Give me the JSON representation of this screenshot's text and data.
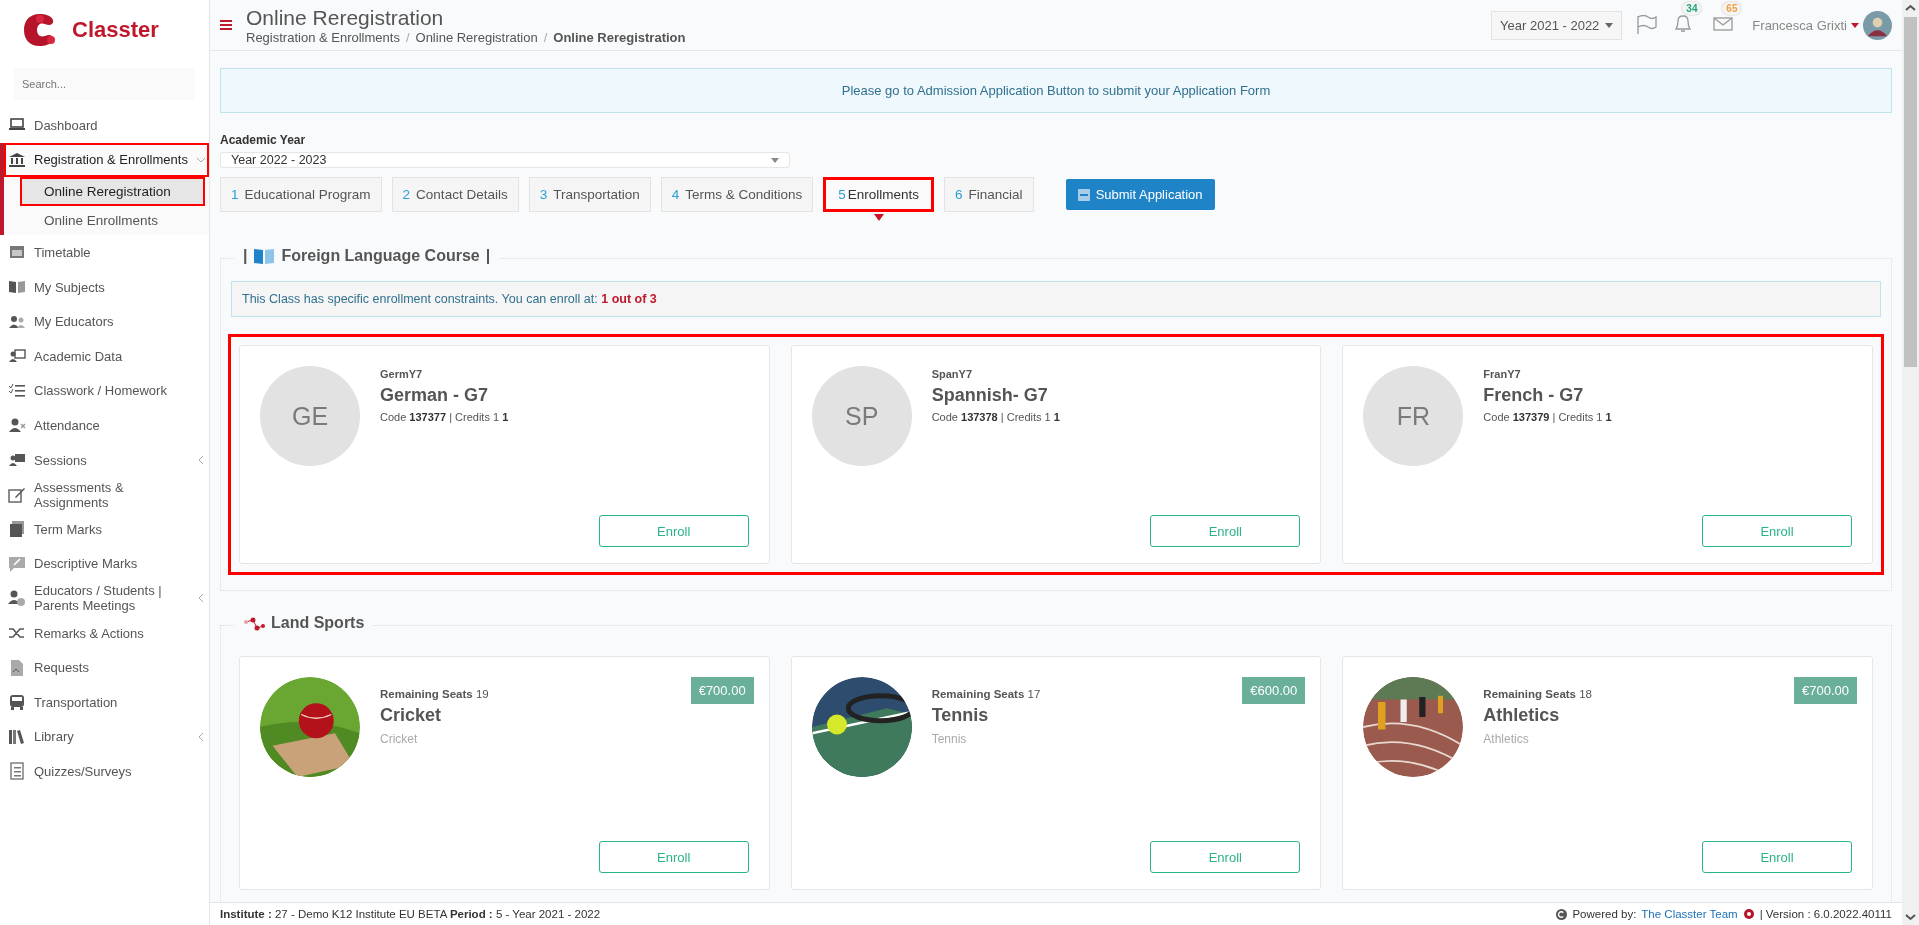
{
  "sidebar": {
    "brand": "Classter",
    "search": {
      "placeholder": "Search..."
    },
    "items": [
      {
        "label": "Dashboard",
        "kind": "link",
        "selected": false,
        "highlighted": false
      },
      {
        "label": "Registration & Enrollments",
        "kind": "menu",
        "expanded": true,
        "selected": true,
        "highlighted": true,
        "children": [
          {
            "label": "Online Reregistration",
            "selected": true,
            "highlighted": true
          },
          {
            "label": "Online Enrollments",
            "selected": false,
            "highlighted": false
          }
        ]
      },
      {
        "label": "Timetable",
        "kind": "link",
        "selected": false,
        "highlighted": false
      },
      {
        "label": "My Subjects",
        "kind": "link",
        "selected": false,
        "highlighted": false
      },
      {
        "label": "My Educators",
        "kind": "link",
        "selected": false,
        "highlighted": false
      },
      {
        "label": "Academic Data",
        "kind": "link",
        "selected": false,
        "highlighted": false
      },
      {
        "label": "Classwork / Homework",
        "kind": "link",
        "selected": false,
        "highlighted": false
      },
      {
        "label": "Attendance",
        "kind": "link",
        "selected": false,
        "highlighted": false
      },
      {
        "label": "Sessions",
        "kind": "menu",
        "expanded": false,
        "selected": false,
        "highlighted": false
      },
      {
        "label": "Assessments & Assignments",
        "kind": "link",
        "selected": false,
        "highlighted": false
      },
      {
        "label": "Term Marks",
        "kind": "link",
        "selected": false,
        "highlighted": false
      },
      {
        "label": "Descriptive Marks",
        "kind": "link",
        "selected": false,
        "highlighted": false
      },
      {
        "label": "Educators / Students | Parents Meetings",
        "kind": "menu",
        "expanded": false,
        "selected": false,
        "highlighted": false
      },
      {
        "label": "Remarks & Actions",
        "kind": "link",
        "selected": false,
        "highlighted": false
      },
      {
        "label": "Requests",
        "kind": "link",
        "selected": false,
        "highlighted": false
      },
      {
        "label": "Transportation",
        "kind": "link",
        "selected": false,
        "highlighted": false
      },
      {
        "label": "Library",
        "kind": "menu",
        "expanded": false,
        "selected": false,
        "highlighted": false
      },
      {
        "label": "Quizzes/Surveys",
        "kind": "link",
        "selected": false,
        "highlighted": false
      }
    ]
  },
  "header": {
    "title": "Online Reregistration",
    "breadcrumbs": [
      {
        "kind": "link",
        "label": "Registration & Enrollments"
      },
      {
        "kind": "separator",
        "label": "/"
      },
      {
        "kind": "link",
        "label": "Online Reregistration"
      },
      {
        "kind": "separator",
        "label": "/"
      },
      {
        "kind": "current",
        "label": "Online Reregistration"
      }
    ],
    "year_select": "Year 2021 - 2022",
    "notifications": "34",
    "messages": "65",
    "user": "Francesca Grixti"
  },
  "notice": "Please go to Admission Application Button to submit your Application Form",
  "academic_year": {
    "label": "Academic Year",
    "value": "Year 2022 - 2023"
  },
  "tabs": [
    {
      "number": "1",
      "label": "Educational Program",
      "selected": false,
      "highlighted": false
    },
    {
      "number": "2",
      "label": "Contact Details",
      "selected": false,
      "highlighted": false
    },
    {
      "number": "3",
      "label": "Transportation",
      "selected": false,
      "highlighted": false
    },
    {
      "number": "4",
      "label": "Terms & Conditions",
      "selected": false,
      "highlighted": false
    },
    {
      "number": "5",
      "label": "Enrollments",
      "selected": true,
      "highlighted": true
    },
    {
      "number": "6",
      "label": "Financial",
      "selected": false,
      "highlighted": false
    }
  ],
  "submit_button": "Submit Application",
  "sections": [
    {
      "kind": "course",
      "title_before": "|",
      "title": "Foreign Language Course",
      "title_after": "|",
      "notice": "This Class has specific enrollment constraints. You can enroll at: **1 out of 3**",
      "highlighted": true,
      "cards": [
        {
          "initials": "GE",
          "code": "GermY7",
          "title": "German - G7",
          "details": "Code **137377** | Credits 1 **1**",
          "button": "Enroll"
        },
        {
          "initials": "SP",
          "code": "SpanY7",
          "title": "Spannish- G7",
          "details": "Code **137378** | Credits 1 **1**",
          "button": "Enroll"
        },
        {
          "initials": "FR",
          "code": "FranY7",
          "title": "French - G7",
          "details": "Code **137379** | Credits 1 **1**",
          "button": "Enroll"
        }
      ]
    },
    {
      "kind": "sport",
      "title": "Land Sports",
      "highlighted": false,
      "cards": [
        {
          "seats_label": "Remaining Seats",
          "seats": "19",
          "title": "Cricket",
          "subtitle": "Cricket",
          "price": "€700.00",
          "button": "Enroll"
        },
        {
          "seats_label": "Remaining Seats",
          "seats": "17",
          "title": "Tennis",
          "subtitle": "Tennis",
          "price": "€600.00",
          "button": "Enroll"
        },
        {
          "seats_label": "Remaining Seats",
          "seats": "18",
          "title": "Athletics",
          "subtitle": "Athletics",
          "price": "€700.00",
          "button": "Enroll"
        }
      ]
    }
  ],
  "footer": {
    "info": "**Institute :** 27 - Demo K12 Institute EU BETA **Period :** 5 - Year 2021 - 2022",
    "powered": "Powered by:",
    "team_link": "The Classter Team",
    "version": "| Version : 6.0.2022.40111"
  }
}
